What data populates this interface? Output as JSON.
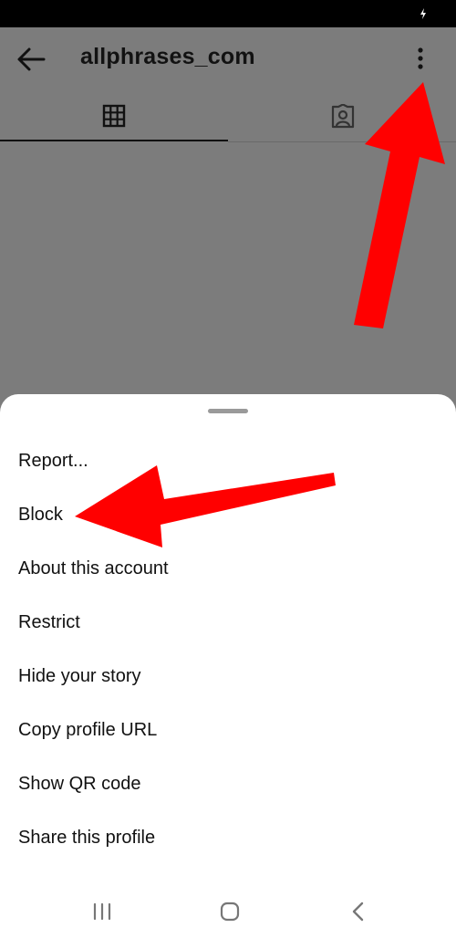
{
  "header": {
    "title": "allphrases_com"
  },
  "icons": {
    "back": "arrow-left-icon",
    "more": "more-vertical-icon",
    "grid_tab": "grid-icon",
    "tagged_tab": "tagged-person-icon"
  },
  "menu": {
    "items": [
      {
        "label": "Report..."
      },
      {
        "label": "Block"
      },
      {
        "label": "About this account"
      },
      {
        "label": "Restrict"
      },
      {
        "label": "Hide your story"
      },
      {
        "label": "Copy profile URL"
      },
      {
        "label": "Show QR code"
      },
      {
        "label": "Share this profile"
      }
    ]
  },
  "colors": {
    "overlay": "#7c7c7c",
    "sheet": "#ffffff",
    "annotation_arrow": "#ff0000"
  }
}
